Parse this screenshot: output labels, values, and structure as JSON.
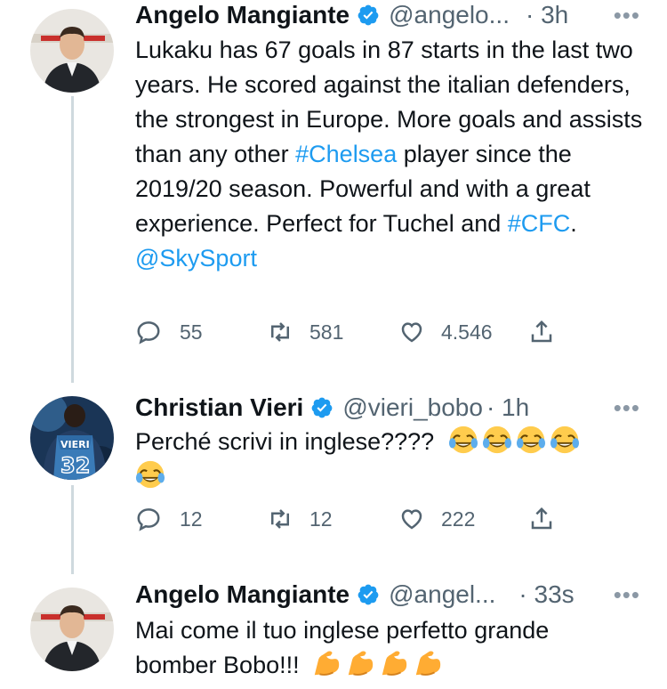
{
  "tweets": [
    {
      "author": "Angelo Mangiante",
      "handle": "@angelo...",
      "time": "· 3h",
      "text_parts": [
        "Lukaku has 67 goals in 87 starts in the last two years. He scored against the italian defenders, the strongest in Europe. More goals and assists than any other ",
        "#Chelsea",
        " player since the 2019/20 season. Powerful and with a great experience. Perfect for Tuchel and ",
        "#CFC",
        ".",
        "@SkySport"
      ],
      "replies": "55",
      "retweets": "581",
      "likes": "4.546"
    },
    {
      "author": "Christian Vieri",
      "handle": "@vieri_bobo",
      "time": "· 1h",
      "text": "Perché scrivi in inglese????",
      "emoji": "face-with-tears-of-joy-emoji",
      "emoji_count": 5,
      "replies": "12",
      "retweets": "12",
      "likes": "222"
    },
    {
      "author": "Angelo Mangiante",
      "handle": "@angel...",
      "time": "· 33s",
      "text_line1": "Mai come il tuo inglese perfetto grande",
      "text_line2": "bomber Bobo!!!",
      "emoji": "flexed-biceps-emoji",
      "emoji_count": 4
    }
  ],
  "more_label": "•••",
  "colors": {
    "link": "#1d9bf0",
    "verified": "#1d9bf0",
    "muted": "#536471"
  }
}
